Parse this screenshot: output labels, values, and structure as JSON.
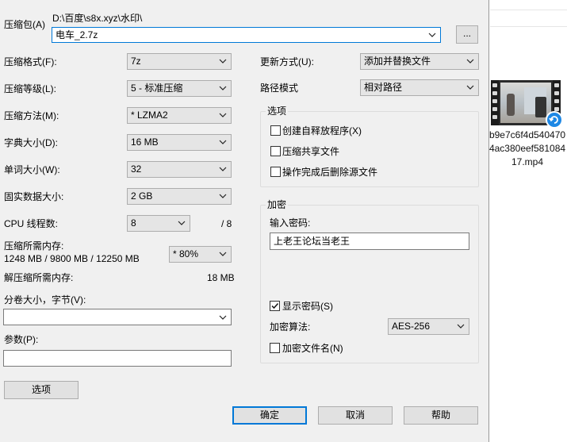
{
  "dialog": {
    "archive_label": "压缩包(A)",
    "archive_path": "D:\\百度\\s8x.xyz\\水印\\",
    "archive_name": "电车_2.7z",
    "browse_button": "...",
    "format_label": "压缩格式(F):",
    "format_value": "7z",
    "level_label": "压缩等级(L):",
    "level_value": "5 - 标准压缩",
    "method_label": "压缩方法(M):",
    "method_value": "*  LZMA2",
    "dict_label": "字典大小(D):",
    "dict_value": "16 MB",
    "word_label": "单词大小(W):",
    "word_value": "32",
    "solid_label": "固实数据大小:",
    "solid_value": "2 GB",
    "threads_label": "CPU 线程数:",
    "threads_value": "8",
    "threads_total": "/ 8",
    "mem_label": "压缩所需内存:",
    "mem_value": "1248 MB / 9800 MB / 12250 MB",
    "mem_percent": "* 80%",
    "decomp_mem_label": "解压缩所需内存:",
    "decomp_mem_value": "18 MB",
    "split_label": "分卷大小，字节(V):",
    "split_value": "",
    "params_label": "参数(P):",
    "params_value": "",
    "options_button": "选项",
    "update_label": "更新方式(U):",
    "update_value": "添加并替换文件",
    "pathmode_label": "路径模式",
    "pathmode_value": "相对路径",
    "options_group": {
      "title": "选项",
      "sfx": "创建自释放程序(X)",
      "shared": "压缩共享文件",
      "delete": "操作完成后删除源文件"
    },
    "encryption_group": {
      "title": "加密",
      "password_label": "输入密码:",
      "password_value": "上老王论坛当老王",
      "show_password": "显示密码(S)",
      "algo_label": "加密算法:",
      "algo_value": "AES-256",
      "encrypt_names": "加密文件名(N)"
    },
    "ok_button": "确定",
    "cancel_button": "取消",
    "help_button": "帮助"
  },
  "desktop": {
    "file_name": "b9e7c6f4d5404704ac380eef58108417.mp4"
  },
  "colors": {
    "dialog_bg": "#f0f0f0",
    "accent": "#0078d7"
  },
  "checkbox_states": {
    "sfx": false,
    "shared": false,
    "delete": false,
    "show_password": true,
    "encrypt_names": false
  }
}
